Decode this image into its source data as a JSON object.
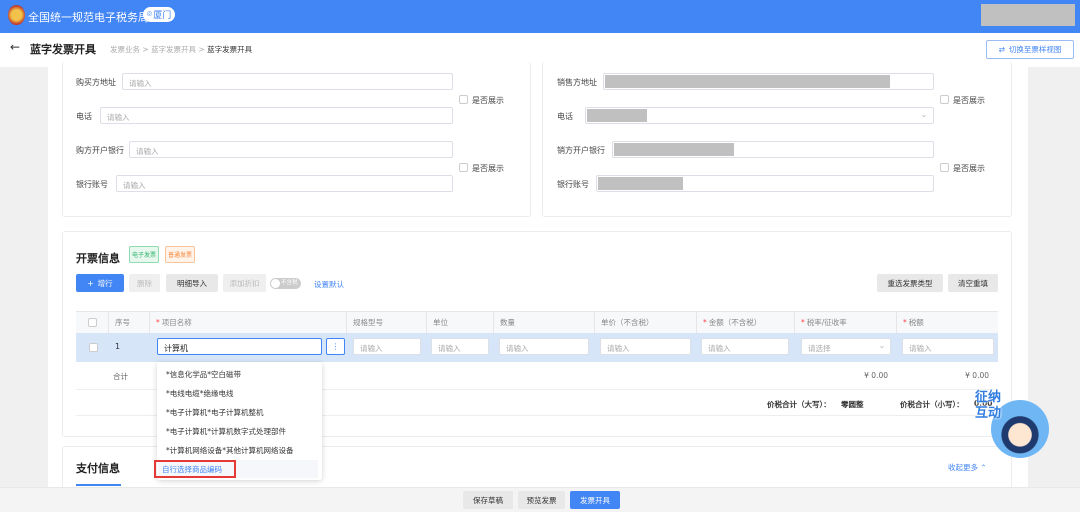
{
  "header": {
    "app_title": "全国统一规范电子税务局",
    "location": "厦门",
    "brand_color": "#4285f4"
  },
  "subheader": {
    "title": "蓝字发票开具",
    "breadcrumb": [
      "发票业务",
      "蓝字发票开具",
      "蓝字发票开具"
    ],
    "switch_view": "切换至票样视图"
  },
  "buyer": {
    "fields": [
      {
        "label": "购买方地址",
        "placeholder": "请输入"
      },
      {
        "label": "电话",
        "placeholder": "请输入"
      },
      {
        "label": "购方开户银行",
        "placeholder": "请输入"
      },
      {
        "label": "银行账号",
        "placeholder": "请输入"
      }
    ],
    "show_label": "是否展示"
  },
  "seller": {
    "fields": [
      {
        "label": "销售方地址"
      },
      {
        "label": "电话"
      },
      {
        "label": "销方开户银行"
      },
      {
        "label": "银行账号"
      }
    ],
    "show_label": "是否展示"
  },
  "invoice": {
    "title": "开票信息",
    "tags": [
      "电子发票",
      "普通发票"
    ],
    "buttons": {
      "add_row": "增行",
      "delete": "删除",
      "import": "明细导入",
      "discount": "添加折扣",
      "toggle": "不含税",
      "set_default": "设置默认",
      "reselect": "重选发票类型",
      "clear": "清空重填"
    },
    "columns": [
      "序号",
      "项目名称",
      "规格型号",
      "单位",
      "数量",
      "单价（不含税）",
      "金额（不含税）",
      "税率/征收率",
      "税额"
    ],
    "row": {
      "index": "1",
      "name": "计算机",
      "placeholder": "请输入",
      "select_placeholder": "请选择"
    },
    "total_label": "合计",
    "total_amount": "¥ 0.00",
    "total_tax": "¥ 0.00",
    "grand_upper_label": "价税合计（大写）：",
    "grand_upper": "零圆整",
    "grand_lower_label": "价税合计（小写）：",
    "grand_lower": "0.00"
  },
  "dropdown": {
    "items": [
      "*信息化学品*空白磁带",
      "*电线电缆*绝缘电线",
      "*电子计算机*电子计算机整机",
      "*电子计算机*计算机数字式处理部件",
      "*计算机网络设备*其他计算机网络设备"
    ],
    "custom": "自行选择商品编码"
  },
  "payment": {
    "title": "支付信息",
    "collapse": "收起更多"
  },
  "footer": {
    "save": "保存草稿",
    "preview": "预览发票",
    "issue": "发票开具"
  },
  "mascot": {
    "text": "征纳互动"
  }
}
